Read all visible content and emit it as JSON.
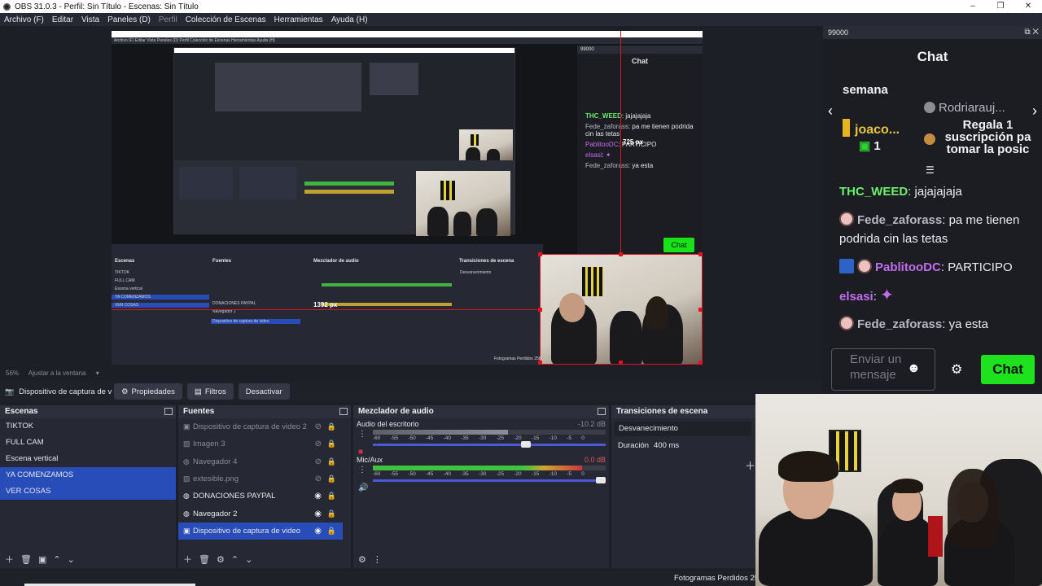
{
  "window": {
    "title": "OBS 31.0.3 - Perfil: Sin Título - Escenas: Sin Título",
    "controls": [
      "–",
      "❐",
      "✕"
    ]
  },
  "menu": [
    "Archivo (F)",
    "Editar",
    "Vista",
    "Paneles (D)",
    "Perfil",
    "Colección de Escenas",
    "Herramientas",
    "Ayuda (H)"
  ],
  "preview": {
    "zoom": "56%",
    "zoom_mode": "Ajustar a la ventana",
    "measure_v": "725 px",
    "measure_h": "1392 px",
    "nested_menu": "Archivo (F)   Editar   Vista   Paneles (D)   Perfil   Colección de Escenas   Herramientas   Ayuda (H)",
    "nested_frames": "Fotogramas Perdidos 258"
  },
  "mini_chat": {
    "channel": "99000",
    "title": "Chat",
    "lines": [
      {
        "user": "THC_WEED",
        "text": "jajajajaja"
      },
      {
        "user": "Fede_zaforass",
        "text": "pa me tienen podrida cin las tetas"
      },
      {
        "user": "PablitooDC",
        "text": "PARTICIPO"
      },
      {
        "user": "elsasi",
        "text": ""
      },
      {
        "user": "Fede_zaforass",
        "text": "ya esta"
      }
    ],
    "button": "Chat"
  },
  "source_toolbar": {
    "source_name": "Dispositivo de captura de v",
    "buttons": [
      "Propiedades",
      "Filtros",
      "Desactivar"
    ]
  },
  "scenes": {
    "title": "Escenas",
    "items": [
      "TIKTOK",
      "FULL CAM",
      "Escena vertical",
      "YA COMENZAMOS",
      "VER COSAS"
    ],
    "selected": [
      3,
      4
    ]
  },
  "sources": {
    "title": "Fuentes",
    "items": [
      {
        "name": "Dispositivo de captura de video 2",
        "icon": "camera-icon",
        "visible": false
      },
      {
        "name": "Imagen 3",
        "icon": "image-icon",
        "visible": false
      },
      {
        "name": "Navegador 4",
        "icon": "globe-icon",
        "visible": false
      },
      {
        "name": "extesible.png",
        "icon": "image-icon",
        "visible": false
      },
      {
        "name": "DONACIONES PAYPAL",
        "icon": "globe-icon",
        "visible": true
      },
      {
        "name": "Navegador 2",
        "icon": "globe-icon",
        "visible": true
      },
      {
        "name": "Dispositivo de captura de video",
        "icon": "camera-icon",
        "visible": true,
        "selected": true
      }
    ]
  },
  "mixer": {
    "title": "Mezclador de audio",
    "channels": [
      {
        "name": "Audio del escritorio",
        "db": "-10.2 dB",
        "level": 0.58,
        "volume": 0.68,
        "muted": true
      },
      {
        "name": "Mic/Aux",
        "db": "0.0 dB",
        "level": 0.9,
        "volume": 1.0,
        "muted": false
      }
    ],
    "scale": [
      "-60",
      "-55",
      "-50",
      "-45",
      "-40",
      "-35",
      "-30",
      "-25",
      "-20",
      "-15",
      "-10",
      "-5",
      "0"
    ]
  },
  "transitions": {
    "title": "Transiciones de escena",
    "selected": "Desvanecimiento",
    "duration_label": "Duración",
    "duration_value": "400 ms"
  },
  "status": {
    "frames": "Fotogramas Perdidos 258"
  },
  "chat_panel": {
    "channel": "99000",
    "title": "Chat",
    "hype": {
      "word": "semana",
      "top_user": "joaco...",
      "top_count": "1",
      "gift_user": "Rodriarauj...",
      "gift_text": "Regala 1 suscripción pa tomar la posic"
    },
    "messages": [
      {
        "user": "THC_WEED",
        "text": "jajajajaja",
        "color": "#6cf06c"
      },
      {
        "user": "Fede_zaforass",
        "text": "pa me tienen podrida cin las tetas",
        "color": "#b8b8c0"
      },
      {
        "user": "PablitooDC",
        "text": "PARTICIPO",
        "color": "#c46cf0"
      },
      {
        "user": "elsasi",
        "text": "",
        "color": "#c46cf0"
      },
      {
        "user": "Fede_zaforass",
        "text": "ya esta",
        "color": "#b8b8c0"
      }
    ],
    "input_placeholder": "Enviar un mensaje",
    "send_button": "Chat"
  },
  "colors": {
    "selection": "#284cb8",
    "accent_green": "#1ee21e",
    "guide_red": "#e0141e"
  }
}
